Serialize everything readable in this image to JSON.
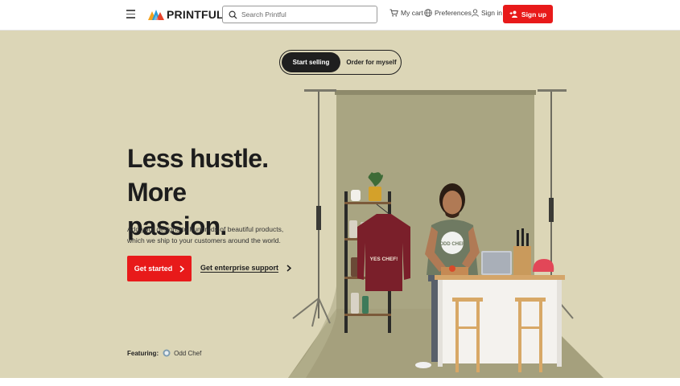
{
  "header": {
    "logo_text": "PRINTFUL",
    "search": {
      "placeholder": "Search Printful",
      "value": ""
    },
    "cart_label": "My cart",
    "preferences_label": "Preferences",
    "signin_label": "Sign in",
    "signup_label": "Sign up",
    "accent_color": "#e81a1a"
  },
  "hero": {
    "toggle": {
      "active_label": "Start selling",
      "inactive_label": "Order for myself"
    },
    "headline_line1": "Less hustle. More",
    "headline_line2": "passion.",
    "subtext": "Add your designs to hundreds of beautiful products, which we ship to your customers around the world.",
    "primary_cta": "Get started",
    "secondary_cta": "Get enterprise support",
    "featuring_label": "Featuring:",
    "featuring_brand": "Odd Chef",
    "shirt_print": "YES CHEF!",
    "tee_print": "ODD CHEF",
    "background_color": "#dcd6b7",
    "backdrop_color": "#a9a582"
  },
  "icons": [
    "menu-icon",
    "logo-icon",
    "search-icon",
    "cart-icon",
    "globe-icon",
    "user-icon",
    "add-user-icon",
    "chevron-right-icon",
    "brand-badge-icon"
  ]
}
